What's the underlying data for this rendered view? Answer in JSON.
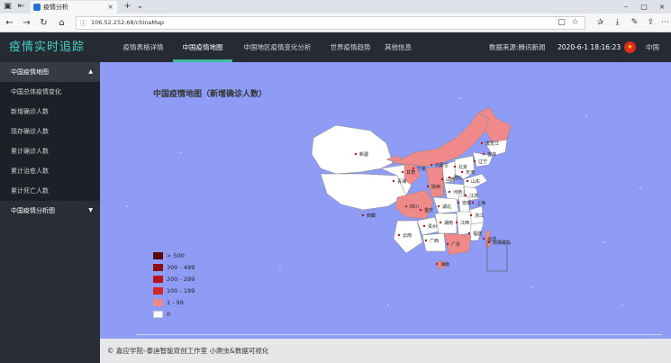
{
  "browser": {
    "tab_title": "疫情分析",
    "new_tab": "+",
    "url": "106.52.252.68/chinaMap"
  },
  "header": {
    "logo": "疫情实时追踪",
    "nav": [
      "疫情表格详情",
      "中国疫情地图",
      "中国地区疫情变化分析",
      "世界疫情趋势",
      "其他信息"
    ],
    "active_nav": "中国疫情地图",
    "source": "数据来源:腾讯新闻",
    "time": "2020-6-1 18:16:23",
    "lang": "中国"
  },
  "sidebar": {
    "group1": "中国疫情地图",
    "items": [
      "中国总体疫情变化",
      "新增确诊人数",
      "现存确诊人数",
      "累计确诊人数",
      "累计治愈人数",
      "累计死亡人数"
    ],
    "group2": "中国疫情分析图"
  },
  "map": {
    "title": "中国疫情地图（新增确诊人数）",
    "legend": [
      {
        "label": "> 500",
        "color": "#5a0a0a"
      },
      {
        "label": "300 - 499",
        "color": "#8a0f14"
      },
      {
        "label": "200 - 299",
        "color": "#b5161c"
      },
      {
        "label": "100 - 199",
        "color": "#d9262a"
      },
      {
        "label": "1 - 99",
        "color": "#f08a8a"
      },
      {
        "label": "0",
        "color": "#ffffff"
      }
    ],
    "province_labels": [
      "新疆",
      "西藏",
      "内蒙古",
      "黑龙江",
      "吉林",
      "辽宁",
      "北京",
      "天津",
      "河北",
      "山西",
      "山东",
      "宁夏",
      "甘肃",
      "青海",
      "陕西",
      "河南",
      "江苏",
      "上海",
      "安徽",
      "湖北",
      "四川",
      "重庆",
      "湖南",
      "江西",
      "浙江",
      "云南",
      "贵州",
      "广西",
      "广东",
      "福建",
      "台湾",
      "海南",
      "南海诸岛"
    ]
  },
  "footer": "© 嘉应学院–泰迪智能双创工作室 小爬虫&数据可视化"
}
